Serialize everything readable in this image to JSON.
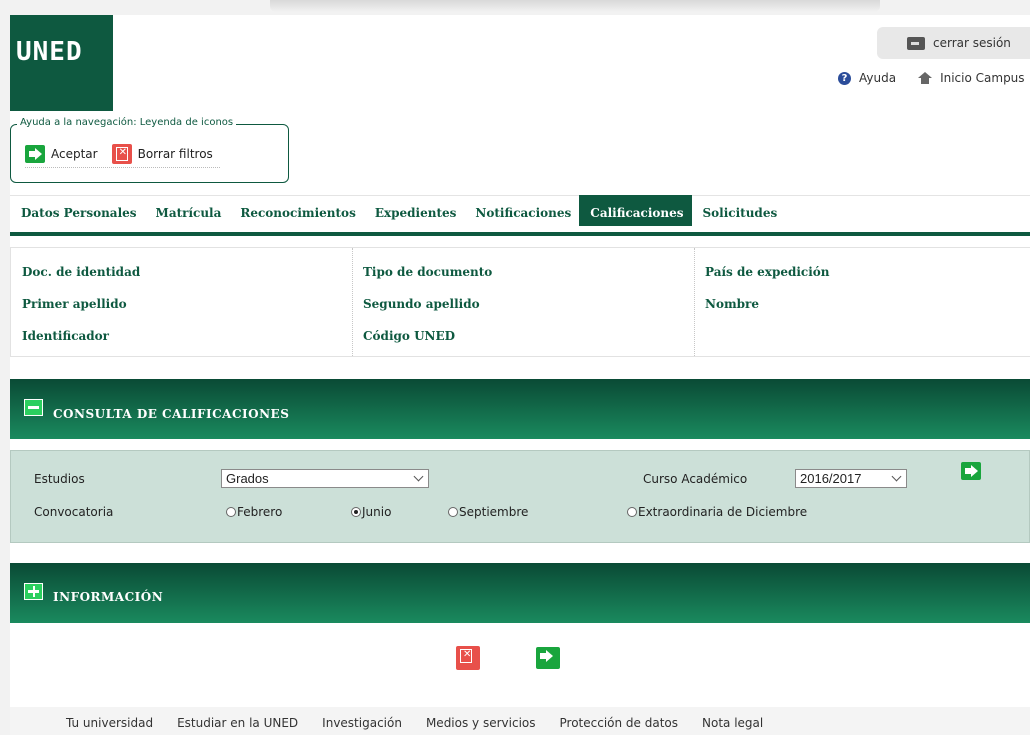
{
  "header": {
    "logo_text": "UNED",
    "logout_label": "cerrar sesión",
    "help_label": "Ayuda",
    "home_label": "Inicio Campus"
  },
  "legend": {
    "title": "Ayuda a la navegación: Leyenda de iconos",
    "accept_label": "Aceptar",
    "clear_label": "Borrar filtros"
  },
  "nav": {
    "tabs": [
      {
        "label": "Datos Personales"
      },
      {
        "label": "Matrícula"
      },
      {
        "label": "Reconocimientos"
      },
      {
        "label": "Expedientes"
      },
      {
        "label": "Notificaciones"
      },
      {
        "label": "Calificaciones"
      },
      {
        "label": "Solicitudes"
      }
    ],
    "active": "Calificaciones"
  },
  "identity": {
    "doc_id": "Doc. de identidad",
    "doc_type": "Tipo de documento",
    "country": "País de expedición",
    "surname1": "Primer apellido",
    "surname2": "Segundo apellido",
    "name": "Nombre",
    "identifier": "Identificador",
    "uned_code": "Código UNED"
  },
  "consulta": {
    "title": "CONSULTA DE CALIFICACIONES",
    "studies_label": "Estudios",
    "studies_value": "Grados",
    "year_label": "Curso Académico",
    "year_value": "2016/2017",
    "convocatoria_label": "Convocatoria",
    "options": [
      {
        "label": "Febrero",
        "checked": false
      },
      {
        "label": "Junio",
        "checked": true
      },
      {
        "label": "Septiembre",
        "checked": false
      },
      {
        "label": "Extraordinaria de Diciembre",
        "checked": false
      }
    ]
  },
  "informacion": {
    "title": "INFORMACIÓN"
  },
  "footer": {
    "links": [
      "Tu universidad",
      "Estudiar en la UNED",
      "Investigación",
      "Medios y servicios",
      "Protección de datos",
      "Nota legal"
    ]
  }
}
